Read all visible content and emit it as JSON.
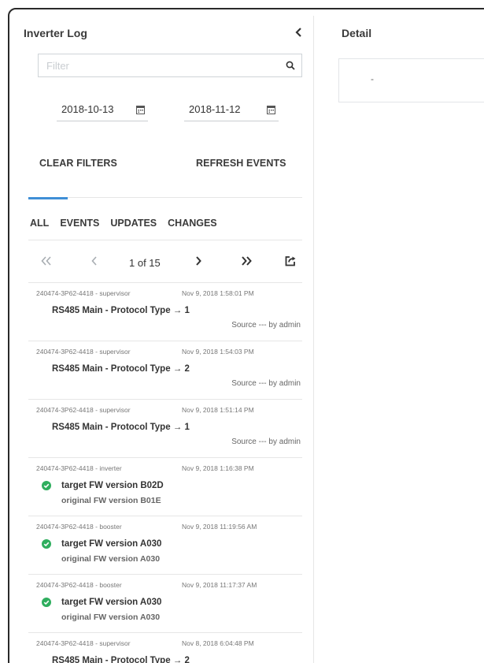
{
  "left": {
    "title": "Inverter Log",
    "filter": {
      "placeholder": "Filter",
      "value": ""
    },
    "dates": {
      "from": "2018-10-13",
      "to": "2018-11-12"
    },
    "actions": {
      "clear": "CLEAR FILTERS",
      "refresh": "REFRESH EVENTS"
    },
    "tabs": [
      "ALL",
      "EVENTS",
      "UPDATES",
      "CHANGES"
    ],
    "active_tab": "ALL",
    "pager": {
      "first": "«",
      "prev": "‹",
      "page_text": "1 of 15",
      "next": "›",
      "last": "»"
    },
    "items": [
      {
        "id": "240474-3P62-4418 - supervisor",
        "time": "Nov 9, 2018 1:58:01 PM",
        "main": "RS485 Main - Protocol Type → 1",
        "source": "Source --- by admin"
      },
      {
        "id": "240474-3P62-4418 - supervisor",
        "time": "Nov 9, 2018 1:54:03 PM",
        "main": "RS485 Main - Protocol Type → 2",
        "source": "Source --- by admin"
      },
      {
        "id": "240474-3P62-4418 - supervisor",
        "time": "Nov 9, 2018 1:51:14 PM",
        "main": "RS485 Main - Protocol Type → 1",
        "source": "Source --- by admin"
      },
      {
        "id": "240474-3P62-4418 - inverter",
        "time": "Nov 9, 2018 1:16:38 PM",
        "main": "target FW version B02D",
        "sub": "original FW version B01E",
        "ok": true
      },
      {
        "id": "240474-3P62-4418 - booster",
        "time": "Nov 9, 2018 11:19:56 AM",
        "main": "target FW version A030",
        "sub": "original FW version A030",
        "ok": true
      },
      {
        "id": "240474-3P62-4418 - booster",
        "time": "Nov 9, 2018 11:17:37 AM",
        "main": "target FW version A030",
        "sub": "original FW version A030",
        "ok": true
      },
      {
        "id": "240474-3P62-4418 - supervisor",
        "time": "Nov 8, 2018 6:04:48 PM",
        "main": "RS485 Main - Protocol Type → 2",
        "source": ""
      }
    ]
  },
  "right": {
    "title": "Detail",
    "value": "-"
  },
  "colors": {
    "accent": "#3f8fd6",
    "success": "#2fae5e",
    "border": "#e6e6e6"
  }
}
